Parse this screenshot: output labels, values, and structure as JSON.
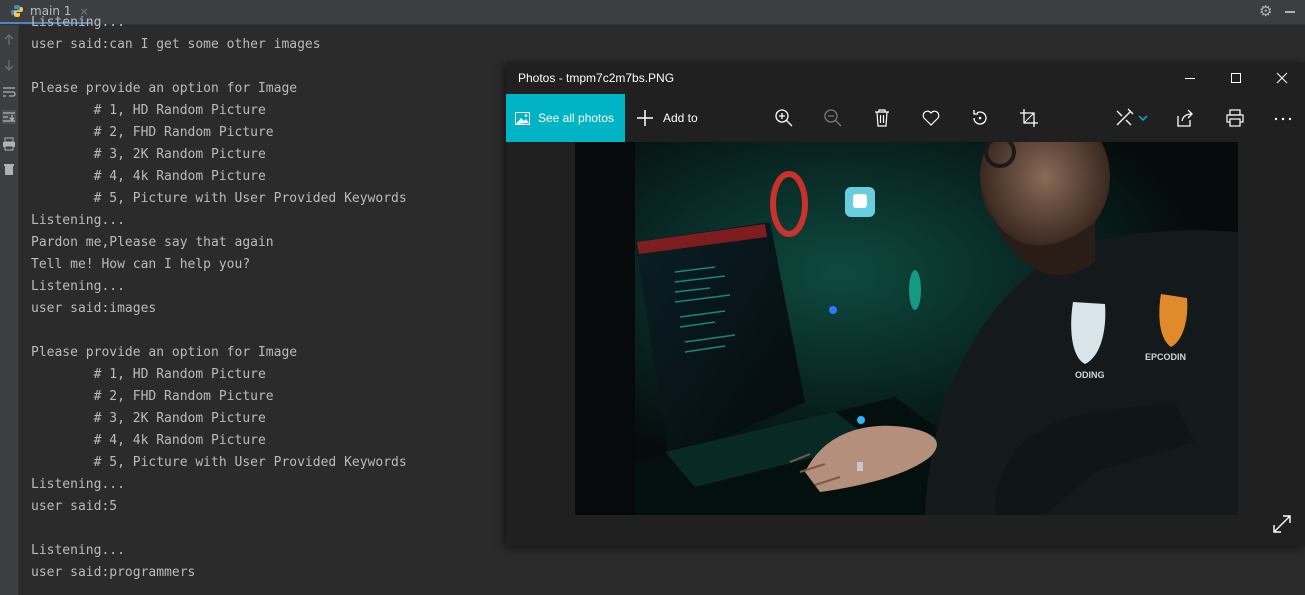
{
  "ide": {
    "tab_label": "main 1",
    "tab_close": "×"
  },
  "console": {
    "lines": [
      "Listening...",
      "user said:can I get some other images",
      "",
      "Please provide an option for Image",
      "        # 1, HD Random Picture",
      "        # 2, FHD Random Picture",
      "        # 3, 2K Random Picture",
      "        # 4, 4k Random Picture",
      "        # 5, Picture with User Provided Keywords",
      "Listening...",
      "Pardon me,Please say that again",
      "Tell me! How can I help you?",
      "Listening...",
      "user said:images",
      "",
      "Please provide an option for Image",
      "        # 1, HD Random Picture",
      "        # 2, FHD Random Picture",
      "        # 3, 2K Random Picture",
      "        # 4, 4k Random Picture",
      "        # 5, Picture with User Provided Keywords",
      "Listening...",
      "user said:5",
      "",
      "Listening...",
      "user said:programmers"
    ]
  },
  "photos": {
    "title": "Photos - tmpm7c2m7bs.PNG",
    "see_all_label": "See all photos",
    "add_to_label": "Add to",
    "accent": "#00b4c5",
    "toolbar_icons": [
      "zoom-in-icon",
      "zoom-out-icon",
      "delete-icon",
      "favorite-icon",
      "rotate-icon",
      "crop-icon",
      "edit-icon",
      "share-icon",
      "print-icon",
      "more-icon"
    ],
    "shirt_text_left": "ODING",
    "shirt_text_right": "EPCODIN"
  }
}
